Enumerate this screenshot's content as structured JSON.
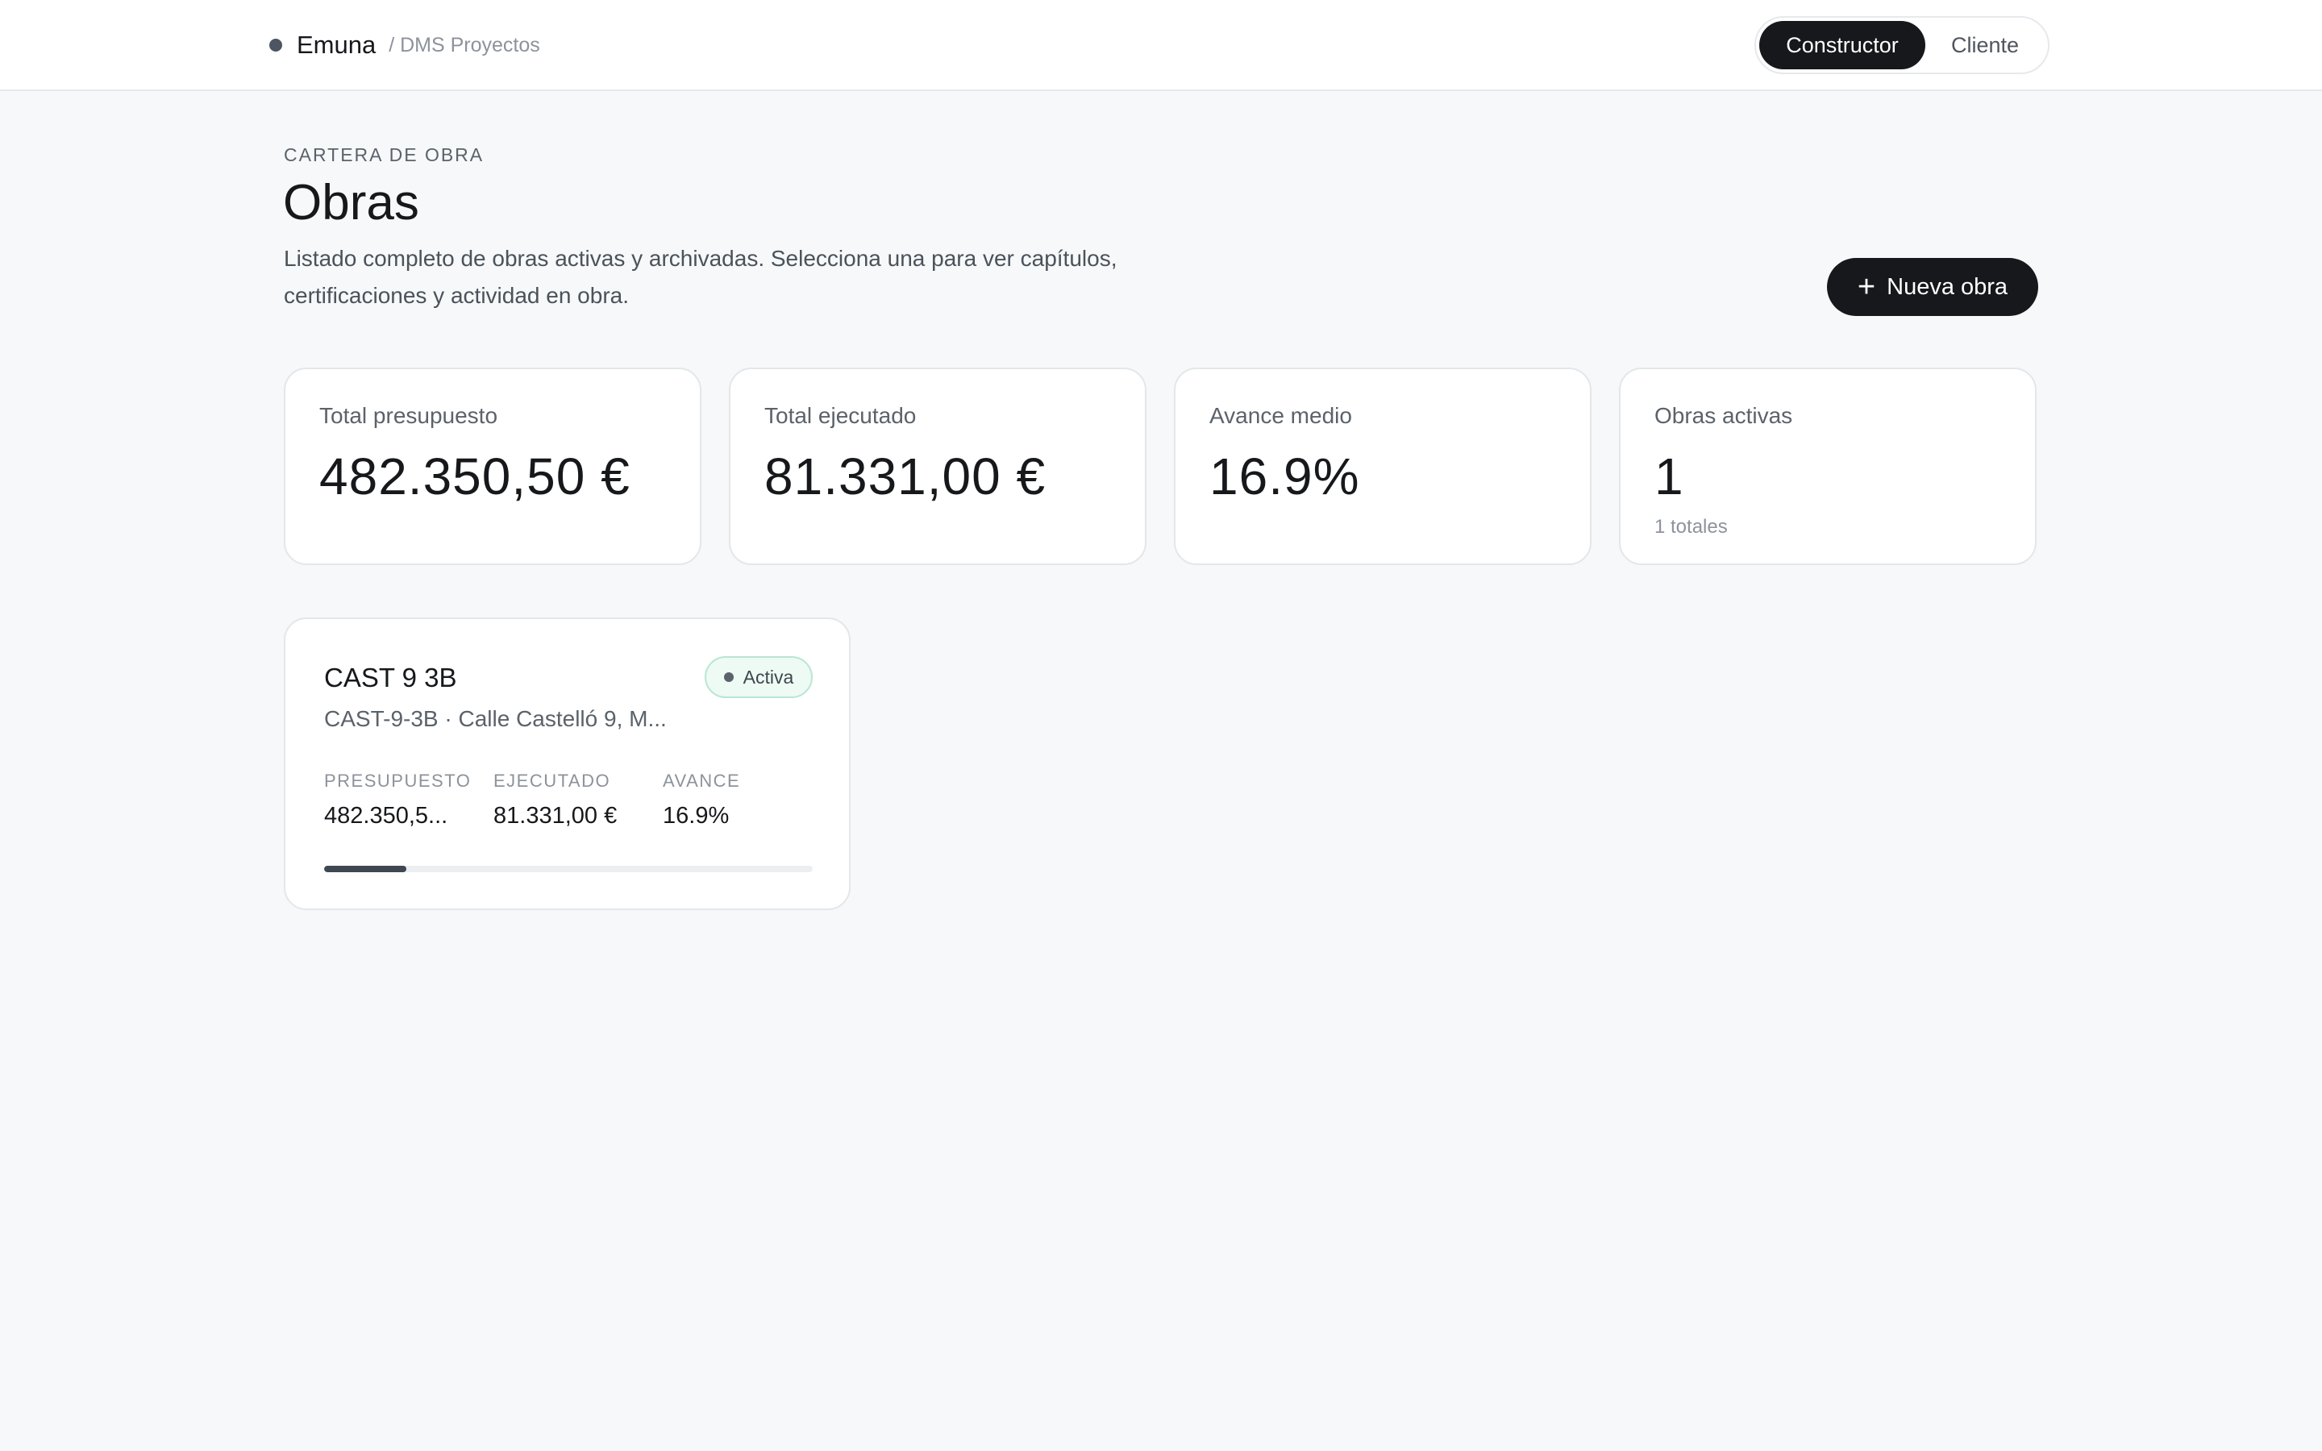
{
  "app": {
    "name": "Emuna",
    "section": "/ DMS Proyectos"
  },
  "roles": {
    "active": "Constructor",
    "inactive": "Cliente"
  },
  "header": {
    "eyebrow": "CARTERA DE OBRA",
    "title": "Obras",
    "description": "Listado completo de obras activas y archivadas. Selecciona una para ver capítulos, certificaciones y actividad en obra.",
    "new_button_label": "Nueva obra",
    "new_button_icon": "plus-icon"
  },
  "stats": [
    {
      "label": "Total presupuesto",
      "value": "482.350,50 €",
      "sub": ""
    },
    {
      "label": "Total ejecutado",
      "value": "81.331,00 €",
      "sub": ""
    },
    {
      "label": "Avance medio",
      "value": "16.9%",
      "sub": ""
    },
    {
      "label": "Obras activas",
      "value": "1",
      "sub": "1 totales"
    }
  ],
  "projects": [
    {
      "name": "CAST 9 3B",
      "subtitle": "CAST-9-3B · Calle Castelló 9, M...",
      "status": "Activa",
      "metrics": {
        "budget_label": "PRESUPUESTO",
        "budget_value": "482.350,5...",
        "executed_label": "EJECUTADO",
        "executed_value": "81.331,00 €",
        "progress_label": "AVANCE",
        "progress_value": "16.9%"
      },
      "progress_fraction": 0.169
    }
  ],
  "colors": {
    "background": "#f6f8f9",
    "primary": "#16181b",
    "status_active_bg": "#eefaf4",
    "status_active_border": "#b9e6d2",
    "progress_fill": "#3f4852"
  }
}
